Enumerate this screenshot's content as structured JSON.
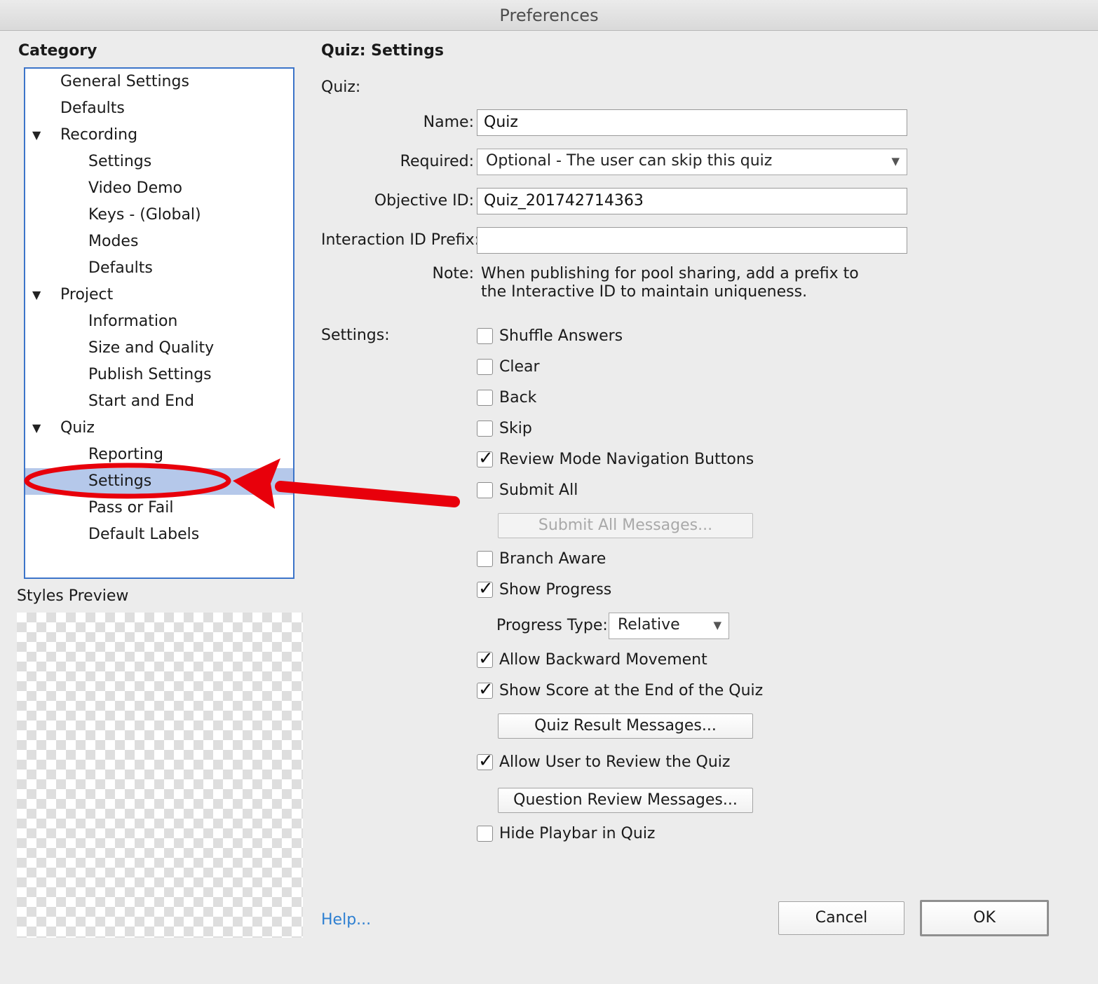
{
  "window": {
    "title": "Preferences"
  },
  "sidebar": {
    "category_heading": "Category",
    "items": [
      {
        "label": "General Settings",
        "level": 1
      },
      {
        "label": "Defaults",
        "level": 1
      },
      {
        "label": "Recording",
        "level": 1,
        "expandable": true
      },
      {
        "label": "Settings",
        "level": 2
      },
      {
        "label": "Video Demo",
        "level": 2
      },
      {
        "label": "Keys - (Global)",
        "level": 2
      },
      {
        "label": "Modes",
        "level": 2
      },
      {
        "label": "Defaults",
        "level": 2
      },
      {
        "label": "Project",
        "level": 1,
        "expandable": true
      },
      {
        "label": "Information",
        "level": 2
      },
      {
        "label": "Size and Quality",
        "level": 2
      },
      {
        "label": "Publish Settings",
        "level": 2
      },
      {
        "label": "Start and End",
        "level": 2
      },
      {
        "label": "Quiz",
        "level": 1,
        "expandable": true
      },
      {
        "label": "Reporting",
        "level": 2
      },
      {
        "label": "Settings",
        "level": 2,
        "selected": true
      },
      {
        "label": "Pass or Fail",
        "level": 2
      },
      {
        "label": "Default Labels",
        "level": 2
      }
    ],
    "expand_glyph": "▼",
    "styles_preview_label": "Styles Preview"
  },
  "main": {
    "heading": "Quiz: Settings",
    "quiz_section_label": "Quiz:",
    "name_label": "Name:",
    "name_value": "Quiz",
    "required_label": "Required:",
    "required_value": "Optional - The user can skip this quiz",
    "objective_label": "Objective ID:",
    "objective_value": "Quiz_201742714363",
    "interaction_label": "Interaction ID Prefix:",
    "interaction_value": "",
    "note_label": "Note:",
    "note_line1": "When publishing for pool sharing, add a prefix to",
    "note_line2": "the Interactive ID to maintain uniqueness.",
    "settings_label": "Settings:",
    "checkboxes": {
      "shuffle": {
        "label": "Shuffle Answers",
        "checked": false
      },
      "clear": {
        "label": "Clear",
        "checked": false
      },
      "back": {
        "label": "Back",
        "checked": false
      },
      "skip": {
        "label": "Skip",
        "checked": false
      },
      "review_nav": {
        "label": "Review Mode Navigation Buttons",
        "checked": true
      },
      "submit_all": {
        "label": "Submit All",
        "checked": false
      },
      "branch_aware": {
        "label": "Branch Aware",
        "checked": false
      },
      "show_progress": {
        "label": "Show Progress",
        "checked": true
      },
      "allow_backward": {
        "label": "Allow Backward Movement",
        "checked": true
      },
      "show_score": {
        "label": "Show Score at the End of the Quiz",
        "checked": true
      },
      "allow_review": {
        "label": "Allow User to Review the Quiz",
        "checked": true
      },
      "hide_playbar": {
        "label": "Hide Playbar in Quiz",
        "checked": false
      }
    },
    "check_glyph": "✓",
    "submit_all_messages_button": "Submit All Messages...",
    "progress_type_label": "Progress Type:",
    "progress_type_value": "Relative",
    "quiz_result_messages_button": "Quiz Result Messages...",
    "question_review_messages_button": "Question Review Messages...",
    "dropdown_glyph": "▼"
  },
  "footer": {
    "help_link": "Help...",
    "cancel_button": "Cancel",
    "ok_button": "OK"
  },
  "annotation": {
    "color": "#e8000b"
  }
}
